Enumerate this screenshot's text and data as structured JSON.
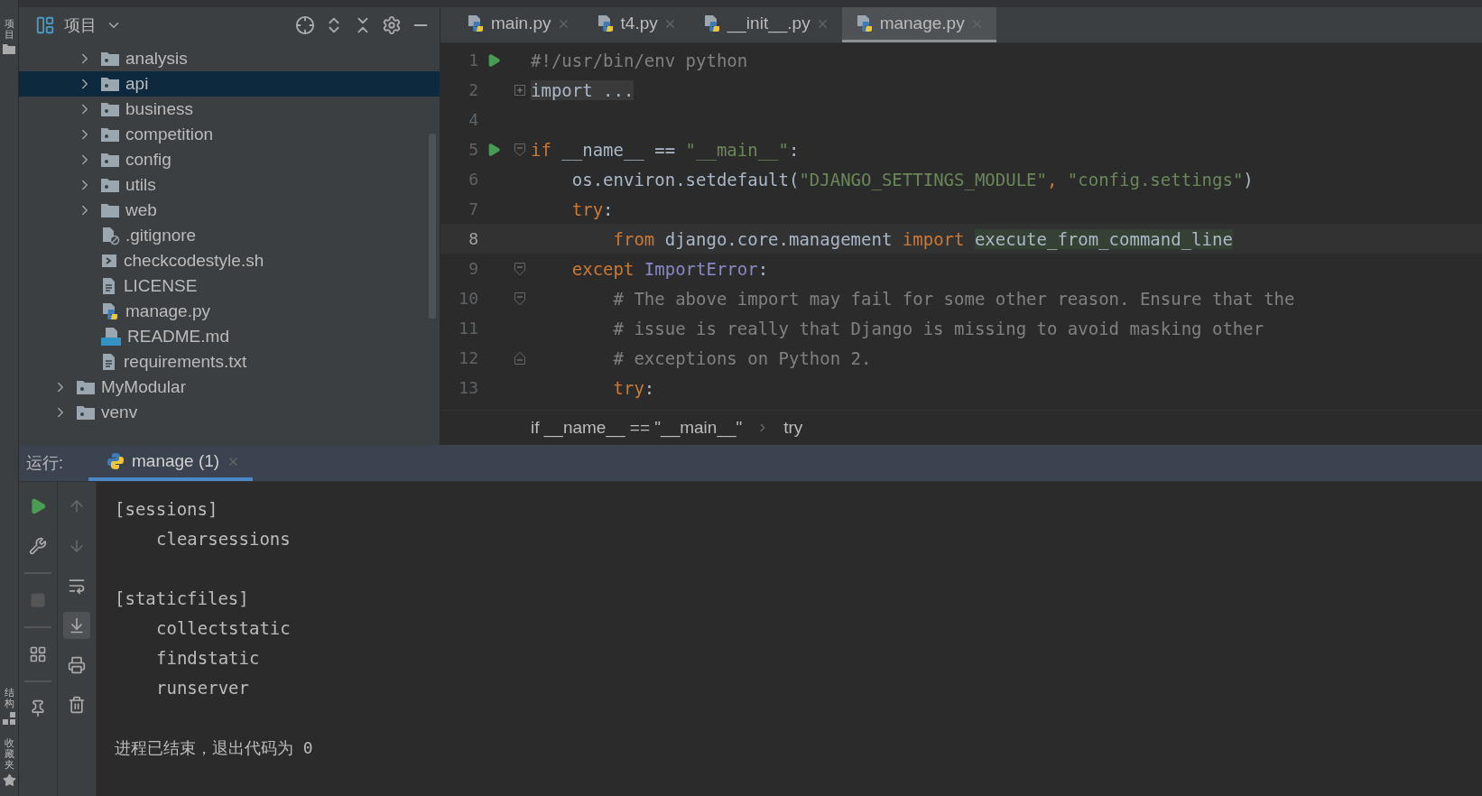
{
  "side_strip": {
    "top": [
      {
        "label": "项目"
      }
    ],
    "bottom": [
      {
        "label": "结构"
      },
      {
        "label": "收藏夹"
      }
    ]
  },
  "project": {
    "title": "项目",
    "tree": [
      {
        "children": [
          {
            "label": "analysis",
            "kind": "folder",
            "expandable": true,
            "selected": false
          },
          {
            "label": "api",
            "kind": "folder",
            "expandable": true,
            "selected": true
          },
          {
            "label": "business",
            "kind": "folder",
            "expandable": true,
            "selected": false
          },
          {
            "label": "competition",
            "kind": "folder",
            "expandable": true,
            "selected": false
          },
          {
            "label": "config",
            "kind": "folder",
            "expandable": true,
            "selected": false
          },
          {
            "label": "utils",
            "kind": "folder",
            "expandable": true,
            "selected": false
          },
          {
            "label": "web",
            "kind": "plainfolder",
            "expandable": true,
            "selected": false
          },
          {
            "label": ".gitignore",
            "kind": "ignore",
            "expandable": false,
            "selected": false
          },
          {
            "label": "checkcodestyle.sh",
            "kind": "shell",
            "expandable": false,
            "selected": false
          },
          {
            "label": "LICENSE",
            "kind": "text",
            "expandable": false,
            "selected": false
          },
          {
            "label": "manage.py",
            "kind": "python",
            "expandable": false,
            "selected": false
          },
          {
            "label": "README.md",
            "kind": "markdown",
            "expandable": false,
            "selected": false
          },
          {
            "label": "requirements.txt",
            "kind": "text",
            "expandable": false,
            "selected": false
          }
        ]
      },
      {
        "label": "MyModular",
        "kind": "folder",
        "expandable": true,
        "selected": false
      },
      {
        "label": "venv",
        "kind": "folder",
        "expandable": true,
        "selected": false
      }
    ]
  },
  "editor": {
    "tabs": [
      {
        "label": "main.py",
        "selected": false
      },
      {
        "label": "t4.py",
        "selected": false
      },
      {
        "label": "__init__.py",
        "selected": false
      },
      {
        "label": "manage.py",
        "selected": true
      }
    ],
    "lines": [
      {
        "number": "1",
        "run": true,
        "collapsed": false,
        "fold_start": false,
        "fold_end": false,
        "current": false,
        "tokens": [
          {
            "kind": "comment",
            "text": "#!/usr/bin/env python"
          }
        ]
      },
      {
        "number": "2",
        "run": false,
        "collapsed": true,
        "fold_start": false,
        "fold_end": false,
        "current": false,
        "tokens": [
          {
            "kind": "folded",
            "text": "import ..."
          }
        ]
      },
      {
        "number": "4",
        "run": false,
        "collapsed": false,
        "fold_start": false,
        "fold_end": false,
        "current": false
      },
      {
        "number": "5",
        "run": true,
        "collapsed": false,
        "fold_start": true,
        "fold_end": false,
        "current": false,
        "tokens": [
          {
            "kind": "keyword",
            "text": "if"
          },
          {
            "kind": "plain",
            "text": " __name__ == "
          },
          {
            "kind": "string",
            "text": "\"__main__\""
          },
          {
            "kind": "plain",
            "text": ":"
          }
        ]
      },
      {
        "number": "6",
        "run": false,
        "collapsed": false,
        "fold_start": false,
        "fold_end": false,
        "current": false,
        "tokens": [
          {
            "kind": "plain",
            "text": "    os.environ.setdefault("
          },
          {
            "kind": "string",
            "text": "\"DJANGO_SETTINGS_MODULE\""
          },
          {
            "kind": "keyword",
            "text": ", "
          },
          {
            "kind": "string",
            "text": "\"config.settings\""
          },
          {
            "kind": "plain",
            "text": ")"
          }
        ]
      },
      {
        "number": "7",
        "run": false,
        "collapsed": false,
        "fold_start": false,
        "fold_end": false,
        "current": false,
        "tokens": [
          {
            "kind": "keyword",
            "text": "    try"
          },
          {
            "kind": "plain",
            "text": ":"
          }
        ]
      },
      {
        "number": "8",
        "run": false,
        "collapsed": false,
        "fold_start": false,
        "fold_end": false,
        "current": true,
        "tokens": [
          {
            "kind": "keyword",
            "text": "        from"
          },
          {
            "kind": "plain",
            "text": " django.core.management "
          },
          {
            "kind": "keyword",
            "text": "import "
          },
          {
            "kind": "highlight",
            "text": "execute_from_command_line"
          }
        ]
      },
      {
        "number": "9",
        "run": false,
        "collapsed": false,
        "fold_start": true,
        "fold_end": false,
        "current": false,
        "tokens": [
          {
            "kind": "keyword",
            "text": "    except "
          },
          {
            "kind": "builtin",
            "text": "ImportError"
          },
          {
            "kind": "plain",
            "text": ":"
          }
        ]
      },
      {
        "number": "10",
        "run": false,
        "collapsed": false,
        "fold_start": true,
        "fold_end": false,
        "current": false,
        "tokens": [
          {
            "kind": "comment",
            "text": "        # The above import may fail for some other reason. Ensure that the"
          }
        ]
      },
      {
        "number": "11",
        "run": false,
        "collapsed": false,
        "fold_start": false,
        "fold_end": false,
        "current": false,
        "tokens": [
          {
            "kind": "comment",
            "text": "        # issue is really that Django is missing to avoid masking other"
          }
        ]
      },
      {
        "number": "12",
        "run": false,
        "collapsed": false,
        "fold_start": false,
        "fold_end": true,
        "current": false,
        "tokens": [
          {
            "kind": "comment",
            "text": "        # exceptions on Python 2."
          }
        ]
      },
      {
        "number": "13",
        "run": false,
        "collapsed": false,
        "fold_start": false,
        "fold_end": false,
        "current": false,
        "tokens": [
          {
            "kind": "keyword",
            "text": "        try"
          },
          {
            "kind": "plain",
            "text": ":"
          }
        ]
      }
    ],
    "breadcrumbs": [
      "if __name__ == \"__main__\"",
      "try"
    ]
  },
  "run": {
    "title": "运行:",
    "tab": {
      "label": "manage (1)",
      "selected": true
    },
    "output": [
      {
        "header": "[sessions]",
        "commands": [
          "clearsessions"
        ]
      },
      {
        "header": "[staticfiles]",
        "commands": [
          "collectstatic",
          "findstatic",
          "runserver"
        ]
      }
    ],
    "exit_message": "进程已结束，退出代码为 0"
  }
}
